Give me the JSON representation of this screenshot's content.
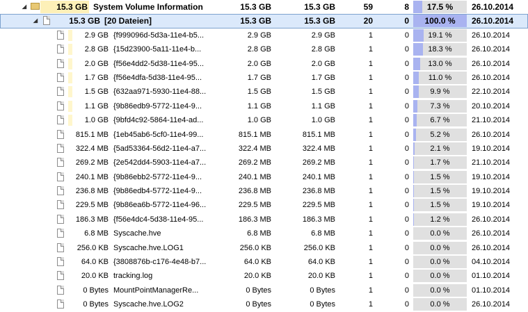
{
  "folder": {
    "size": "15.3 GB",
    "name": "System Volume Information",
    "size2": "15.3 GB",
    "alloc": "15.3 GB",
    "files": "59",
    "folders": "8",
    "percent": "17.5 %",
    "percent_value": 17.5,
    "date": "26.10.2014",
    "expander": "◢",
    "icon": "folder-icon"
  },
  "group": {
    "size": "15.3 GB",
    "name": "[20 Dateien]",
    "size2": "15.3 GB",
    "alloc": "15.3 GB",
    "files": "20",
    "folders": "0",
    "percent": "100.0 %",
    "percent_value": 100.0,
    "date": "26.10.2014",
    "expander": "◢",
    "icon": "file-icon"
  },
  "files": [
    {
      "size": "2.9 GB",
      "name": "{f999096d-5d3a-11e4-b5...",
      "size2": "2.9 GB",
      "alloc": "2.9 GB",
      "files": "1",
      "folders": "0",
      "percent": "19.1 %",
      "pv": 19.1,
      "date": "26.10.2014",
      "bar": 0.85
    },
    {
      "size": "2.8 GB",
      "name": "{15d23900-5a11-11e4-b...",
      "size2": "2.8 GB",
      "alloc": "2.8 GB",
      "files": "1",
      "folders": "0",
      "percent": "18.3 %",
      "pv": 18.3,
      "date": "26.10.2014",
      "bar": 0.82
    },
    {
      "size": "2.0 GB",
      "name": "{f56e4dd2-5d38-11e4-95...",
      "size2": "2.0 GB",
      "alloc": "2.0 GB",
      "files": "1",
      "folders": "0",
      "percent": "13.0 %",
      "pv": 13.0,
      "date": "26.10.2014",
      "bar": 0.6
    },
    {
      "size": "1.7 GB",
      "name": "{f56e4dfa-5d38-11e4-95...",
      "size2": "1.7 GB",
      "alloc": "1.7 GB",
      "files": "1",
      "folders": "0",
      "percent": "11.0 %",
      "pv": 11.0,
      "date": "26.10.2014",
      "bar": 0.5
    },
    {
      "size": "1.5 GB",
      "name": "{632aa971-5930-11e4-88...",
      "size2": "1.5 GB",
      "alloc": "1.5 GB",
      "files": "1",
      "folders": "0",
      "percent": "9.9 %",
      "pv": 9.9,
      "date": "22.10.2014",
      "bar": 0.45
    },
    {
      "size": "1.1 GB",
      "name": "{9b86edb9-5772-11e4-9...",
      "size2": "1.1 GB",
      "alloc": "1.1 GB",
      "files": "1",
      "folders": "0",
      "percent": "7.3 %",
      "pv": 7.3,
      "date": "20.10.2014",
      "bar": 0.33
    },
    {
      "size": "1.0 GB",
      "name": "{9bfd4c92-5864-11e4-ad...",
      "size2": "1.0 GB",
      "alloc": "1.0 GB",
      "files": "1",
      "folders": "0",
      "percent": "6.7 %",
      "pv": 6.7,
      "date": "21.10.2014",
      "bar": 0.3
    },
    {
      "size": "815.1 MB",
      "name": "{1eb45ab6-5cf0-11e4-99...",
      "size2": "815.1 MB",
      "alloc": "815.1 MB",
      "files": "1",
      "folders": "0",
      "percent": "5.2 %",
      "pv": 5.2,
      "date": "26.10.2014",
      "bar": 0
    },
    {
      "size": "322.4 MB",
      "name": "{5ad53364-56d2-11e4-a7...",
      "size2": "322.4 MB",
      "alloc": "322.4 MB",
      "files": "1",
      "folders": "0",
      "percent": "2.1 %",
      "pv": 2.1,
      "date": "19.10.2014",
      "bar": 0
    },
    {
      "size": "269.2 MB",
      "name": "{2e542dd4-5903-11e4-a7...",
      "size2": "269.2 MB",
      "alloc": "269.2 MB",
      "files": "1",
      "folders": "0",
      "percent": "1.7 %",
      "pv": 1.7,
      "date": "21.10.2014",
      "bar": 0
    },
    {
      "size": "240.1 MB",
      "name": "{9b86ebb2-5772-11e4-9...",
      "size2": "240.1 MB",
      "alloc": "240.1 MB",
      "files": "1",
      "folders": "0",
      "percent": "1.5 %",
      "pv": 1.5,
      "date": "19.10.2014",
      "bar": 0
    },
    {
      "size": "236.8 MB",
      "name": "{9b86edb4-5772-11e4-9...",
      "size2": "236.8 MB",
      "alloc": "236.8 MB",
      "files": "1",
      "folders": "0",
      "percent": "1.5 %",
      "pv": 1.5,
      "date": "19.10.2014",
      "bar": 0
    },
    {
      "size": "229.5 MB",
      "name": "{9b86ea6b-5772-11e4-96...",
      "size2": "229.5 MB",
      "alloc": "229.5 MB",
      "files": "1",
      "folders": "0",
      "percent": "1.5 %",
      "pv": 1.5,
      "date": "19.10.2014",
      "bar": 0
    },
    {
      "size": "186.3 MB",
      "name": "{f56e4dc4-5d38-11e4-95...",
      "size2": "186.3 MB",
      "alloc": "186.3 MB",
      "files": "1",
      "folders": "0",
      "percent": "1.2 %",
      "pv": 1.2,
      "date": "26.10.2014",
      "bar": 0
    },
    {
      "size": "6.8 MB",
      "name": "Syscache.hve",
      "size2": "6.8 MB",
      "alloc": "6.8 MB",
      "files": "1",
      "folders": "0",
      "percent": "0.0 %",
      "pv": 0,
      "date": "26.10.2014",
      "bar": 0
    },
    {
      "size": "256.0 KB",
      "name": "Syscache.hve.LOG1",
      "size2": "256.0 KB",
      "alloc": "256.0 KB",
      "files": "1",
      "folders": "0",
      "percent": "0.0 %",
      "pv": 0,
      "date": "26.10.2014",
      "bar": 0
    },
    {
      "size": "64.0 KB",
      "name": "{3808876b-c176-4e48-b7...",
      "size2": "64.0 KB",
      "alloc": "64.0 KB",
      "files": "1",
      "folders": "0",
      "percent": "0.0 %",
      "pv": 0,
      "date": "04.10.2014",
      "bar": 0
    },
    {
      "size": "20.0 KB",
      "name": "tracking.log",
      "size2": "20.0 KB",
      "alloc": "20.0 KB",
      "files": "1",
      "folders": "0",
      "percent": "0.0 %",
      "pv": 0,
      "date": "01.10.2014",
      "bar": 0
    },
    {
      "size": "0 Bytes",
      "name": "MountPointManagerRe...",
      "size2": "0 Bytes",
      "alloc": "0 Bytes",
      "files": "1",
      "folders": "0",
      "percent": "0.0 %",
      "pv": 0,
      "date": "01.10.2014",
      "bar": 0
    },
    {
      "size": "0 Bytes",
      "name": "Syscache.hve.LOG2",
      "size2": "0 Bytes",
      "alloc": "0 Bytes",
      "files": "1",
      "folders": "0",
      "percent": "0.0 %",
      "pv": 0,
      "date": "26.10.2014",
      "bar": 0
    }
  ],
  "colors": {
    "selection": "#dbe9fb",
    "percent_fill": "#a9b3f0",
    "percent_track": "#e0e0e0",
    "size_highlight": "#fdf0b8"
  }
}
